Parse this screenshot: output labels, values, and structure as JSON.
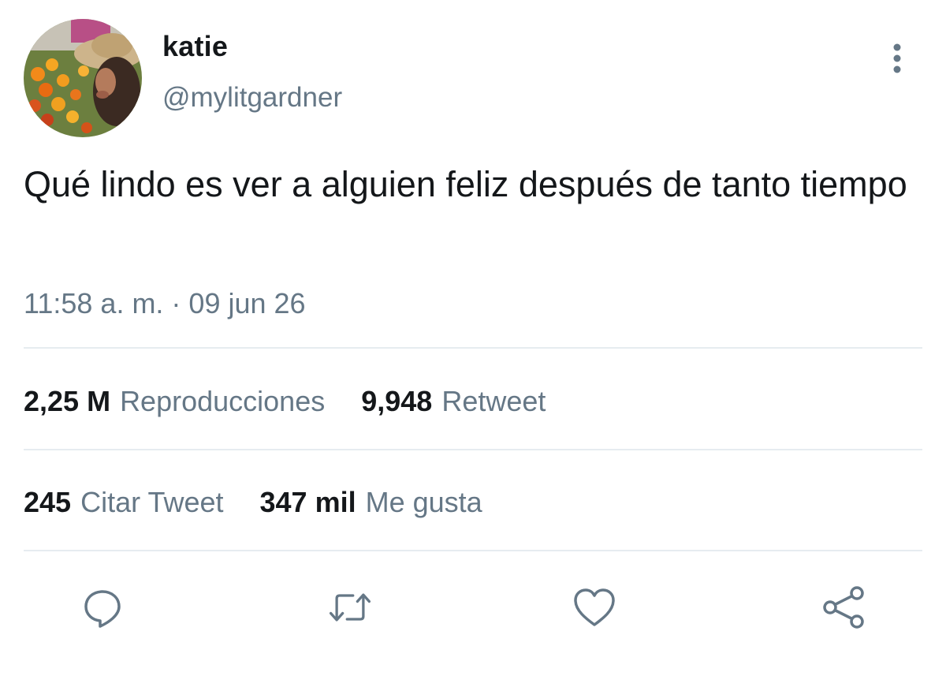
{
  "author": {
    "display_name": "katie",
    "handle": "@mylitgardner"
  },
  "tweet": {
    "text": "Qué lindo es ver a alguien feliz después de tanto tiempo",
    "timestamp": "11:58 a. m. · 09 jun 26"
  },
  "stats": {
    "views_count": "2,25 M",
    "views_label": "Reproducciones",
    "retweets_count": "9,948",
    "retweets_label": "Retweet",
    "quotes_count": "245",
    "quotes_label": "Citar Tweet",
    "likes_count": "347 mil",
    "likes_label": "Me gusta"
  },
  "icons": {
    "more": "more-vertical-icon",
    "reply": "reply-icon",
    "retweet": "retweet-icon",
    "like": "heart-icon",
    "share": "share-icon"
  },
  "colors": {
    "text_primary": "#14171a",
    "text_secondary": "#657786",
    "divider": "#e6ecf0"
  }
}
